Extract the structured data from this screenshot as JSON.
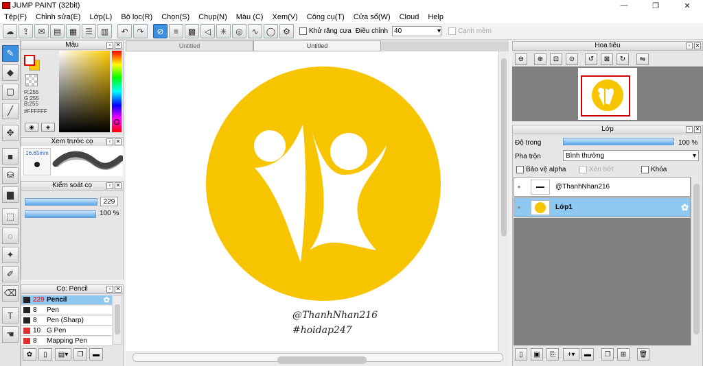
{
  "window": {
    "title": "JUMP PAINT (32bit)",
    "min": "—",
    "max": "❐",
    "close": "✕"
  },
  "menu": [
    "Tệp(F)",
    "Chỉnh sửa(E)",
    "Lớp(L)",
    "Bộ lọc(R)",
    "Chọn(S)",
    "Chụp(N)",
    "Màu (C)",
    "Xem(V)",
    "Công cụ(T)",
    "Cửa sổ(W)",
    "Cloud",
    "Help"
  ],
  "toolbar": {
    "antialias_label": "Khử răng cưa",
    "adjust_label": "Điều chỉnh",
    "adjust_value": "40",
    "edge_label": "Cạnh mềm"
  },
  "color_panel": {
    "title": "Màu",
    "r": "R:255",
    "g": "G:255",
    "b": "B:255",
    "hex": "#FFFFFF"
  },
  "brush_preview": {
    "title": "Xem trước cọ",
    "size": "16.65mm"
  },
  "brush_control": {
    "title": "Kiểm soát cọ",
    "size_value": "229",
    "opacity_value": "100 %",
    "size_level": 1.0,
    "opacity_level": 1.0
  },
  "brush_list": {
    "title": "Cọ: Pencil",
    "items": [
      {
        "size": "229",
        "name": "Pencil",
        "color": "#222222"
      },
      {
        "size": "8",
        "name": "Pen",
        "color": "#222222"
      },
      {
        "size": "8",
        "name": "Pen (Sharp)",
        "color": "#222222"
      },
      {
        "size": "10",
        "name": "G Pen",
        "color": "#e03030"
      },
      {
        "size": "8",
        "name": "Mapping Pen",
        "color": "#e03030"
      }
    ]
  },
  "tabs": [
    "Untitled",
    "Untitled"
  ],
  "canvas": {
    "watermark_1": "@ThanhNhan216",
    "watermark_2": "#hoidap247",
    "logo_color": "#f7c400"
  },
  "navigator": {
    "title": "Hoa tiêu"
  },
  "layers_panel": {
    "title": "Lớp",
    "opacity_label": "Độ trong",
    "opacity_value": "100 %",
    "opacity_level": 1.0,
    "blend_label": "Pha trộn",
    "blend_value": "Bình thường",
    "protect_alpha": "Bảo vệ alpha",
    "clip": "Xén bớt",
    "lock": "Khóa",
    "layers": [
      {
        "name": "@ThanhNhan216",
        "selected": false
      },
      {
        "name": "Lớp1",
        "selected": true
      }
    ]
  }
}
